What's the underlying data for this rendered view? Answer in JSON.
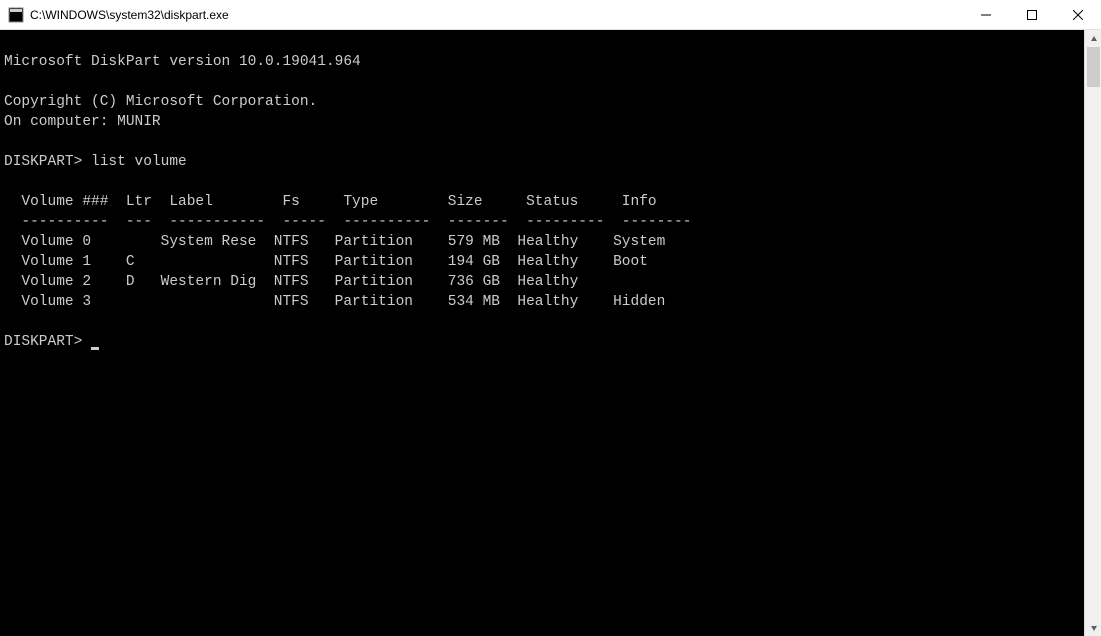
{
  "window": {
    "title": "C:\\WINDOWS\\system32\\diskpart.exe"
  },
  "terminal": {
    "header_version": "Microsoft DiskPart version 10.0.19041.964",
    "copyright": "Copyright (C) Microsoft Corporation.",
    "on_computer": "On computer: MUNIR",
    "prompt1": "DISKPART> list volume",
    "table_header": "  Volume ###  Ltr  Label        Fs     Type        Size     Status     Info",
    "table_divider": "  ----------  ---  -----------  -----  ----------  -------  ---------  --------",
    "volumes": [
      {
        "num": 0,
        "ltr": "",
        "label": "System Rese",
        "fs": "NTFS",
        "type": "Partition",
        "size": "579 MB",
        "status": "Healthy",
        "info": "System"
      },
      {
        "num": 1,
        "ltr": "C",
        "label": "",
        "fs": "NTFS",
        "type": "Partition",
        "size": "194 GB",
        "status": "Healthy",
        "info": "Boot"
      },
      {
        "num": 2,
        "ltr": "D",
        "label": "Western Dig",
        "fs": "NTFS",
        "type": "Partition",
        "size": "736 GB",
        "status": "Healthy",
        "info": ""
      },
      {
        "num": 3,
        "ltr": "",
        "label": "",
        "fs": "NTFS",
        "type": "Partition",
        "size": "534 MB",
        "status": "Healthy",
        "info": "Hidden"
      }
    ],
    "prompt2": "DISKPART> "
  }
}
